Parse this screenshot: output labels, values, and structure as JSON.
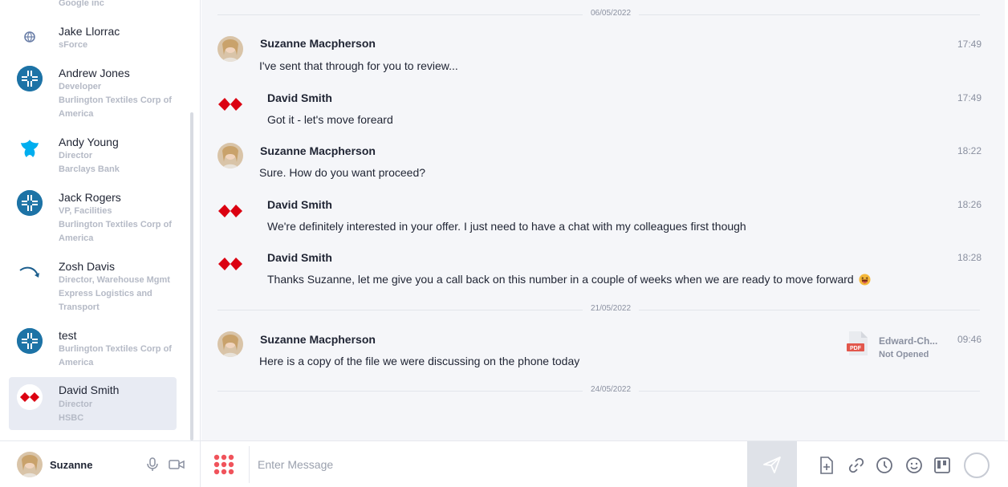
{
  "sidebar": {
    "partial_top": {
      "sub": "Google inc"
    },
    "contacts": [
      {
        "name": "Jake Llorrac",
        "sub1": "sForce",
        "sub2": "",
        "sub3": "",
        "icon": "globe-icon"
      },
      {
        "name": "Andrew Jones",
        "sub1": "Developer",
        "sub2": "Burlington Textiles Corp of",
        "sub3": "America",
        "icon": "burlington-logo-icon"
      },
      {
        "name": "Andy Young",
        "sub1": "Director",
        "sub2": "Barclays Bank",
        "sub3": "",
        "icon": "barclays-eagle-icon"
      },
      {
        "name": "Jack Rogers",
        "sub1": "VP, Facilities",
        "sub2": "Burlington Textiles Corp of",
        "sub3": "America",
        "icon": "burlington-logo-icon"
      },
      {
        "name": "Zosh Davis",
        "sub1": "Director, Warehouse Mgmt",
        "sub2": "Express Logistics and",
        "sub3": "Transport",
        "icon": "express-logo-icon"
      },
      {
        "name": "test",
        "sub1": "Burlington Textiles Corp of",
        "sub2": "America",
        "sub3": "",
        "icon": "burlington-logo-icon"
      },
      {
        "name": "David Smith",
        "sub1": "Director",
        "sub2": "HSBC",
        "sub3": "",
        "icon": "hsbc-logo-icon"
      }
    ]
  },
  "chat": {
    "dividers": [
      "06/05/2022",
      "21/05/2022",
      "24/05/2022"
    ],
    "messages": [
      {
        "sender": "Suzanne Macpherson",
        "time": "17:49",
        "text": "I've sent that through for you to review..."
      },
      {
        "sender": "David Smith",
        "time": "17:49",
        "text": "Got it - let's move foreard"
      },
      {
        "sender": "Suzanne Macpherson",
        "time": "18:22",
        "text": "Sure. How do you want proceed?"
      },
      {
        "sender": "David Smith",
        "time": "18:26",
        "text": "We're definitely interested in your offer. I just need to have a chat with my colleagues first though"
      },
      {
        "sender": "David Smith",
        "time": "18:28",
        "text": "Thanks Suzanne, let me give you a call back on this number in a couple of weeks when we are ready to move forward"
      },
      {
        "sender": "Suzanne Macpherson",
        "time": "09:46",
        "text": "Here is a copy of the file we were discussing on the phone today"
      }
    ],
    "attachment": {
      "filename": "Edward-Ch...",
      "status": "Not Opened",
      "type_label": "PDF"
    }
  },
  "bottom": {
    "me_name": "Suzanne",
    "input_placeholder": "Enter Message"
  },
  "colors": {
    "accent_red": "#db0011",
    "burlington_blue": "#1d73a6",
    "barclays_blue": "#00aeef",
    "dialpad_red": "#f0535b"
  }
}
